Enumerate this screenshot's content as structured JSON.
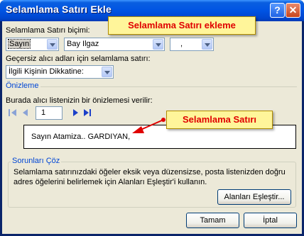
{
  "window": {
    "title": "Selamlama Satırı Ekle",
    "help_label": "?",
    "close_label": "✕"
  },
  "format": {
    "label": "Selamlama Satırı biçimi:",
    "salutation": "Sayın",
    "name_format": "Bay Ilgaz",
    "punctuation": ","
  },
  "invalid": {
    "label": "Geçersiz alıcı adları için selamlama satırı:",
    "value": "İlgili Kişinin Dikkatine:"
  },
  "preview_section": {
    "title": "Önizleme",
    "label": "Burada alıcı listenizin bir önizlemesi verilir:",
    "record": "1",
    "text": "Sayın Atamiza.. GARDIYAN,"
  },
  "problems": {
    "title": "Sorunları Çöz",
    "text_line1": "Selamlama satırınızdaki öğeler eksik veya düzensizse, posta listenizden doğru",
    "text_line2": "adres öğelerini belirlemek için Alanları Eşleştir'i kullanın.",
    "match_button": "Alanları Eşleştir..."
  },
  "buttons": {
    "ok": "Tamam",
    "cancel": "İptal"
  },
  "callouts": {
    "top": "Selamlama Satırı ekleme",
    "middle": "Selamlama Satırı"
  },
  "icons": [
    "first-record-icon",
    "previous-record-icon",
    "next-record-icon",
    "last-record-icon",
    "help-icon",
    "close-icon"
  ],
  "colors": {
    "title_bar": "#0054e3",
    "callout_bg": "#fff59a",
    "callout_text": "#e00000",
    "group_title": "#0046d5"
  }
}
